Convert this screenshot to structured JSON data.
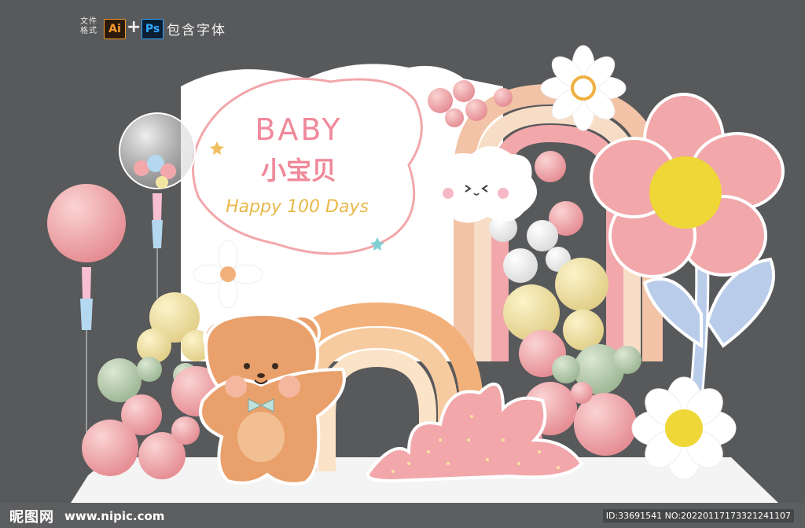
{
  "header": {
    "format_label_line1": "文件",
    "format_label_line2": "格式",
    "ai_badge": "Ai",
    "plus": "+",
    "ps_badge": "Ps",
    "fonts_note": "包含字体"
  },
  "board": {
    "title_en": "BABY",
    "title_cn": "小宝贝",
    "subtitle": "Happy 100 Days"
  },
  "watermark": {
    "logo_text": "昵图网",
    "url": "www.nipic.com",
    "id_text": "ID:33691541 NO:20220117173321241107"
  },
  "colors": {
    "background": "#58595b",
    "pink": "#f2a7aa",
    "deep_pink": "#e98a8f",
    "yellow": "#f3e6a3",
    "sage": "#b9cdb0",
    "orange": "#f2b07a",
    "blue": "#b9cdeb",
    "bear": "#e9a06a"
  }
}
